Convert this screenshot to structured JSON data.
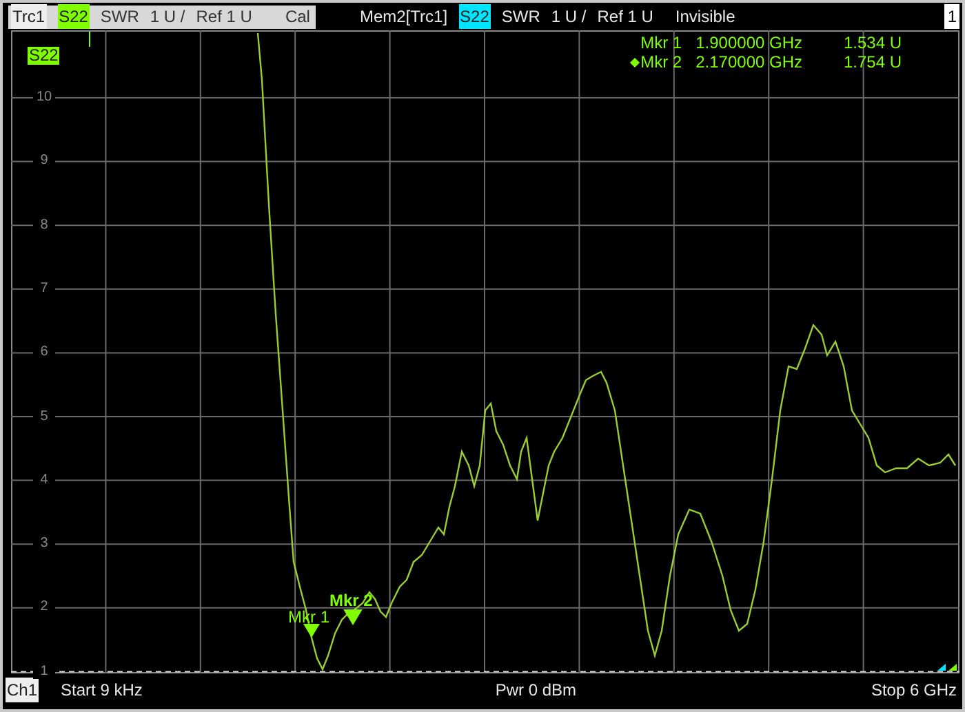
{
  "header": {
    "trace": {
      "label": "Trc1",
      "param": "S22",
      "format": "SWR",
      "scale": "1 U /",
      "ref": "Ref 1 U",
      "cal": "Cal"
    },
    "memory": {
      "label": "Mem2[Trc1]",
      "param": "S22",
      "format": "SWR",
      "scale": "1 U /",
      "ref": "Ref 1 U",
      "state": "Invisible"
    },
    "window_number": "1"
  },
  "plot": {
    "trace_label": "S22",
    "y_ticks": [
      "10",
      "9",
      "8",
      "7",
      "6",
      "5",
      "4",
      "3",
      "2",
      "1"
    ],
    "marker_table": [
      {
        "name": "Mkr 1",
        "freq": "1.900000 GHz",
        "value": "1.534 U",
        "selected": false
      },
      {
        "name": "Mkr 2",
        "freq": "2.170000 GHz",
        "value": "1.754 U",
        "selected": true
      }
    ],
    "markers": [
      {
        "label": "Mkr 1",
        "selected": false
      },
      {
        "label": "Mkr 2",
        "selected": true
      }
    ]
  },
  "footer": {
    "channel": "Ch1",
    "start": "Start 9 kHz",
    "power": "Pwr 0 dBm",
    "stop": "Stop 6 GHz"
  }
}
